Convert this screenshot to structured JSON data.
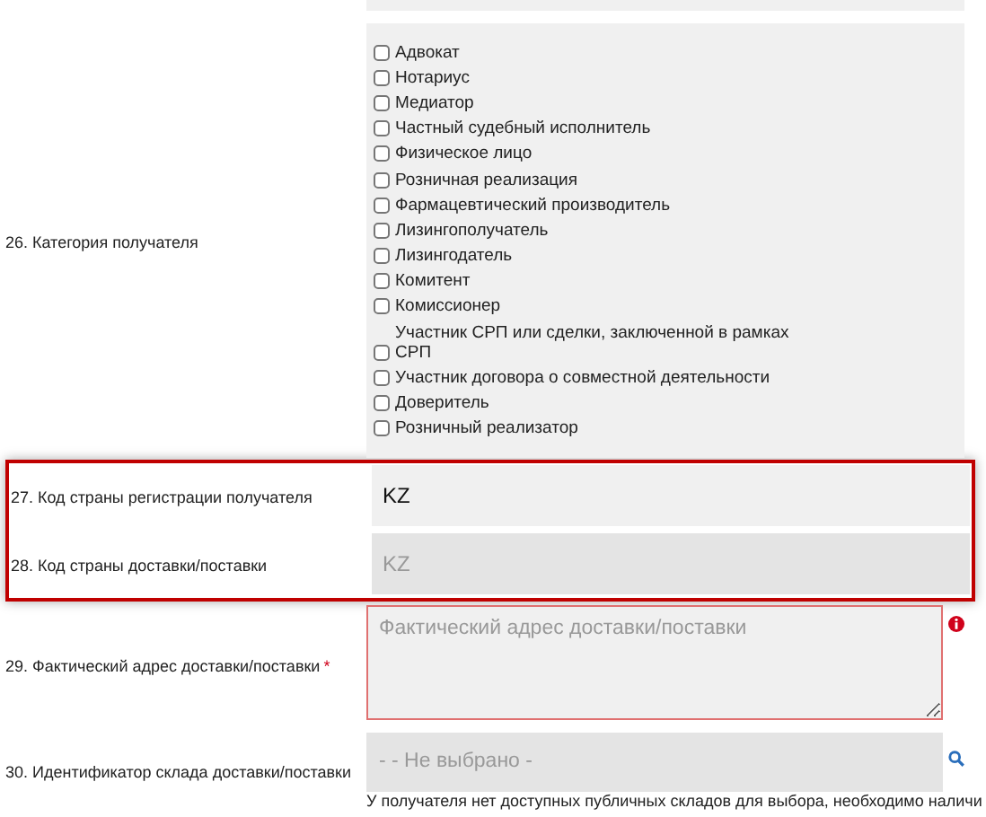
{
  "fields": [
    {
      "kind": "checklist",
      "label": "26. Категория получателя",
      "options": [
        {
          "label": "Адвокат",
          "checked": false
        },
        {
          "label": "Нотариус",
          "checked": false
        },
        {
          "label": "Медиатор",
          "checked": false
        },
        {
          "label": "Частный судебный исполнитель",
          "checked": false
        },
        {
          "label": "Физическое лицо",
          "checked": false
        },
        {
          "label": "Розничная реализация",
          "checked": false
        },
        {
          "label": "Фармацевтический производитель",
          "checked": false
        },
        {
          "label": "Лизингополучатель",
          "checked": false
        },
        {
          "label": "Лизингодатель",
          "checked": false
        },
        {
          "label": "Комитент",
          "checked": false
        },
        {
          "label": "Комиссионер",
          "checked": false
        },
        {
          "label": "Участник СРП или сделки, заключенной в рамках СРП",
          "checked": false
        },
        {
          "label": "Участник договора о совместной деятельности",
          "checked": false
        },
        {
          "label": "Доверитель",
          "checked": false
        },
        {
          "label": "Розничный реализатор",
          "checked": false
        }
      ]
    },
    {
      "kind": "text",
      "label": "27. Код страны регистрации получателя",
      "value": "KZ",
      "disabled": false,
      "highlighted": true
    },
    {
      "kind": "text",
      "label": "28. Код страны доставки/поставки",
      "value": "KZ",
      "disabled": true,
      "highlighted": true
    },
    {
      "kind": "textarea",
      "label": "29. Фактический адрес доставки/поставки",
      "required_mark": "*",
      "placeholder": "Фактический адрес доставки/поставки",
      "error": true
    },
    {
      "kind": "select",
      "label": "30. Идентификатор склада доставки/поставки",
      "placeholder": "- - Не выбрано -",
      "note": "У получателя нет доступных публичных складов для выбора, необходимо наличи"
    }
  ]
}
